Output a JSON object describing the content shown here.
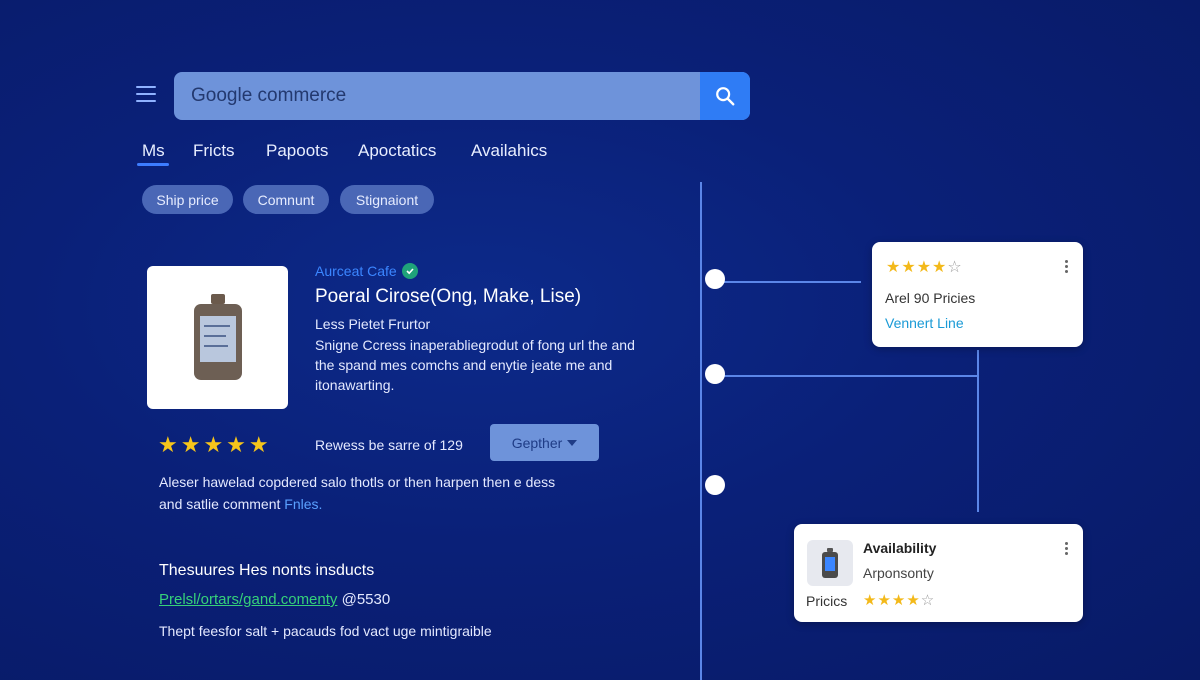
{
  "header": {
    "search_value": "Google commerce",
    "menu_icon": "hamburger-menu-icon",
    "search_icon": "search-icon"
  },
  "tabs": [
    {
      "label": "Ms",
      "active": true
    },
    {
      "label": "Fricts"
    },
    {
      "label": "Papoots"
    },
    {
      "label": "Apoctatics"
    },
    {
      "label": "Availahics"
    }
  ],
  "chips": [
    "Ship price",
    "Comnunt",
    "Stignaiont"
  ],
  "product": {
    "seller": "Aurceat Cafe",
    "title": "Poeral Cirose(Ong, Make, Lise)",
    "subtitle": "Less Pietet Frurtor",
    "description": "Snigne Ccress inaperabliegrodut of fong url the and the spand mes comchs and enytie jeate me and itonawarting.",
    "rating_stars": 5,
    "reviews_text": "Rewess be sarre of 129",
    "dropdown_label": "Gepther",
    "body_text": "Aleser hawelad copdered salo thotls or then harpen then e dess and satlie comment",
    "body_link": "Fnles.",
    "section_heading": "Thesuures Hes nonts insducts",
    "url": "Prelsl/ortars/gand.comenty",
    "url_suffix": "@5530",
    "footer_text": "Thept feesfor salt + pacauds fod vact uge mintigraible"
  },
  "card_top": {
    "rating": 4,
    "rating_max": 5,
    "line1": "Arel 90 Pricies",
    "link": "Vennert Line"
  },
  "card_bottom": {
    "title": "Availability",
    "subtitle": "Arponsonty",
    "price_label": "Pricics",
    "rating": 4,
    "rating_max": 5
  },
  "colors": {
    "background": "#0a2078",
    "accent": "#2f7cf5",
    "link": "#3b86ff",
    "star": "#f6c51b",
    "url_green": "#36d17a"
  }
}
